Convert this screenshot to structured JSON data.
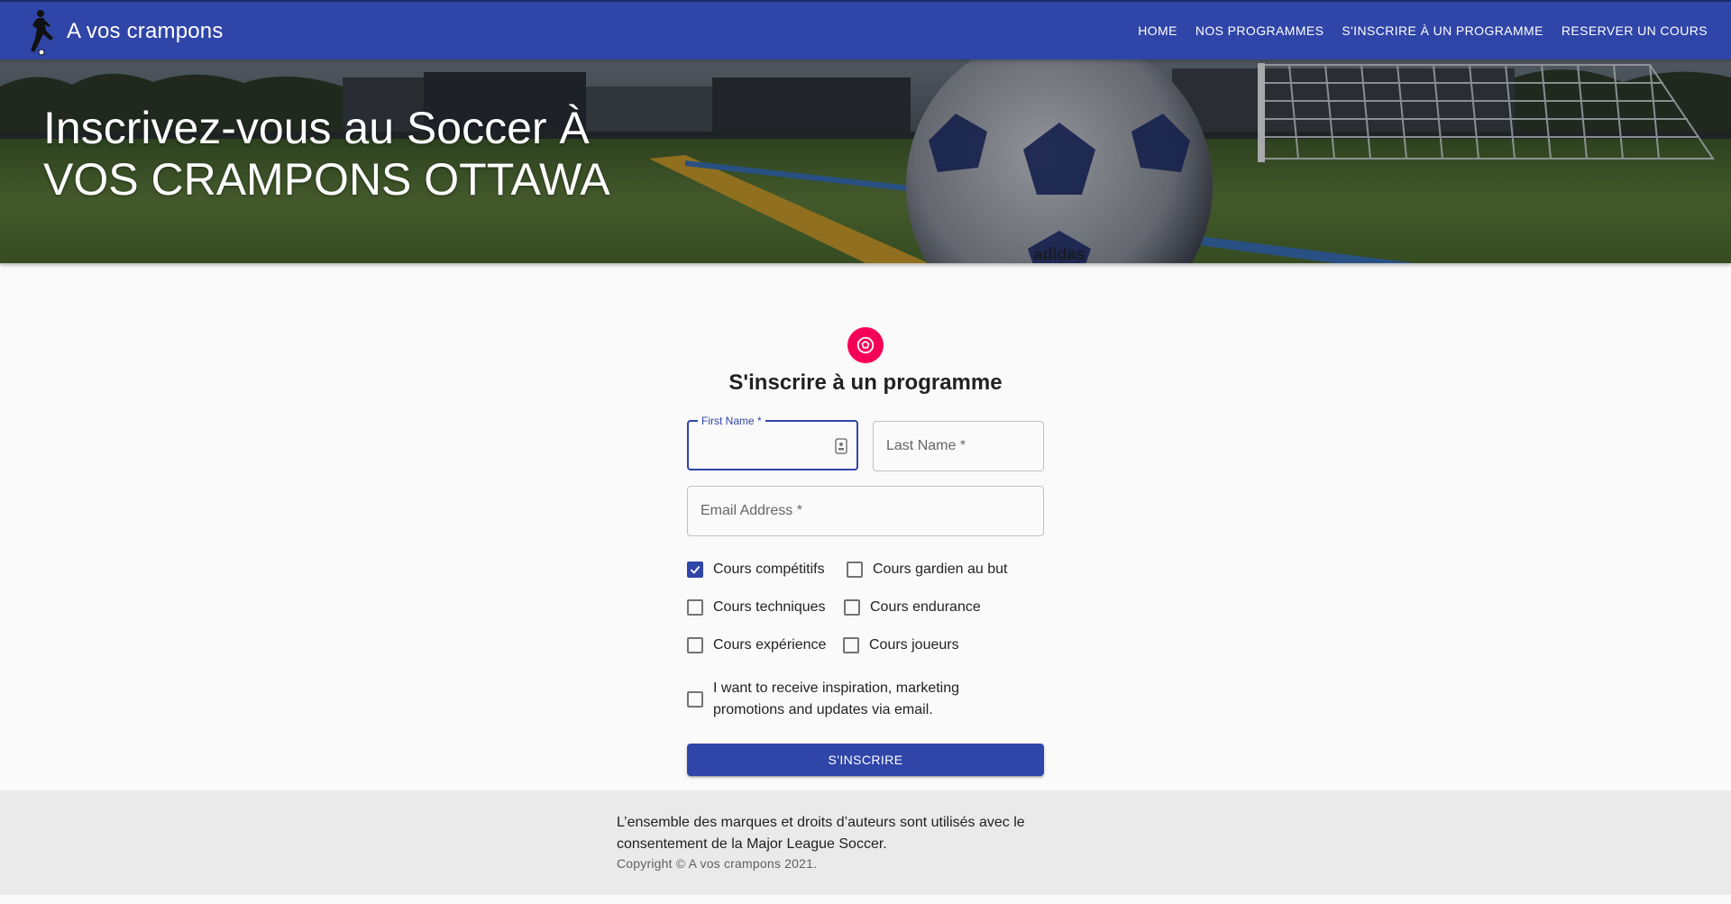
{
  "appbar": {
    "brand": "A vos crampons",
    "nav": [
      {
        "label": "HOME"
      },
      {
        "label": "NOS PROGRAMMES"
      },
      {
        "label": "S'INSCRIRE À UN PROGRAMME"
      },
      {
        "label": "RESERVER UN COURS"
      }
    ]
  },
  "hero": {
    "title": "Inscrivez-vous au Soccer À VOS CRAMPONS OTTAWA"
  },
  "form": {
    "title": "S'inscrire à un programme",
    "first_name": {
      "label": "First Name *",
      "value": ""
    },
    "last_name": {
      "label": "Last Name *",
      "value": ""
    },
    "email": {
      "label": "Email Address *",
      "value": ""
    },
    "courses": [
      {
        "label": "Cours compétitifs",
        "checked": true
      },
      {
        "label": "Cours gardien au but",
        "checked": false
      },
      {
        "label": "Cours techniques",
        "checked": false
      },
      {
        "label": "Cours endurance",
        "checked": false
      },
      {
        "label": "Cours expérience",
        "checked": false
      },
      {
        "label": "Cours joueurs",
        "checked": false
      }
    ],
    "marketing": {
      "label": "I want to receive inspiration, marketing promotions and updates via email.",
      "checked": false
    },
    "submit_label": "S'INSCRIRE"
  },
  "footer": {
    "text": "L’ensemble des marques et droits d’auteurs sont utilisés avec le consentement de la Major League Soccer.",
    "copyright": "Copyright © A vos crampons 2021."
  },
  "colors": {
    "primary": "#3045a8",
    "secondary": "#f50057"
  }
}
